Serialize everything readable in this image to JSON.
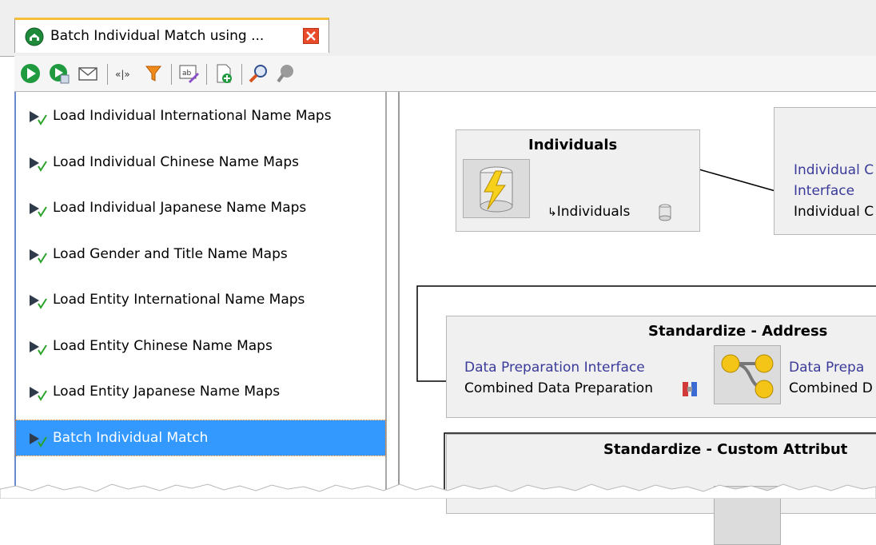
{
  "tab": {
    "title": "Batch Individual Match using ...",
    "icon": "flow-icon",
    "close_icon": "close-icon"
  },
  "toolbar": {
    "buttons": [
      {
        "name": "run-icon"
      },
      {
        "name": "run-options-icon"
      },
      {
        "name": "mail-icon"
      },
      {
        "name": "collapse-icon"
      },
      {
        "name": "filter-icon"
      },
      {
        "name": "edit-label-icon"
      },
      {
        "name": "add-job-icon"
      },
      {
        "name": "zoom-icon"
      },
      {
        "name": "zoom-disabled-icon"
      }
    ]
  },
  "jobs": [
    {
      "label": "Load Individual International Name Maps"
    },
    {
      "label": "Load Individual Chinese Name Maps"
    },
    {
      "label": "Load Individual Japanese Name Maps"
    },
    {
      "label": "Load Gender and Title Name Maps"
    },
    {
      "label": "Load Entity International Name Maps"
    },
    {
      "label": "Load Entity Chinese Name Maps"
    },
    {
      "label": "Load Entity Japanese Name Maps"
    },
    {
      "label": "Batch Individual Match",
      "selected": true
    }
  ],
  "canvas": {
    "individuals": {
      "title": "Individuals",
      "output_label": "Individuals"
    },
    "right_node": {
      "link_line1": "Individual C",
      "link_line2": "Interface",
      "line3": "Individual C"
    },
    "standardize_address": {
      "title": "Standardize - Address",
      "input_link": "Data Preparation Interface",
      "input_text": "Combined Data Preparation",
      "output_link": "Data Prepa",
      "output_text": "Combined D"
    },
    "standardize_custom": {
      "title": "Standardize - Custom Attribut"
    }
  },
  "colors": {
    "selection": "#3399ff",
    "tab_accent": "#f6bf3a",
    "link": "#3a3a9a"
  }
}
